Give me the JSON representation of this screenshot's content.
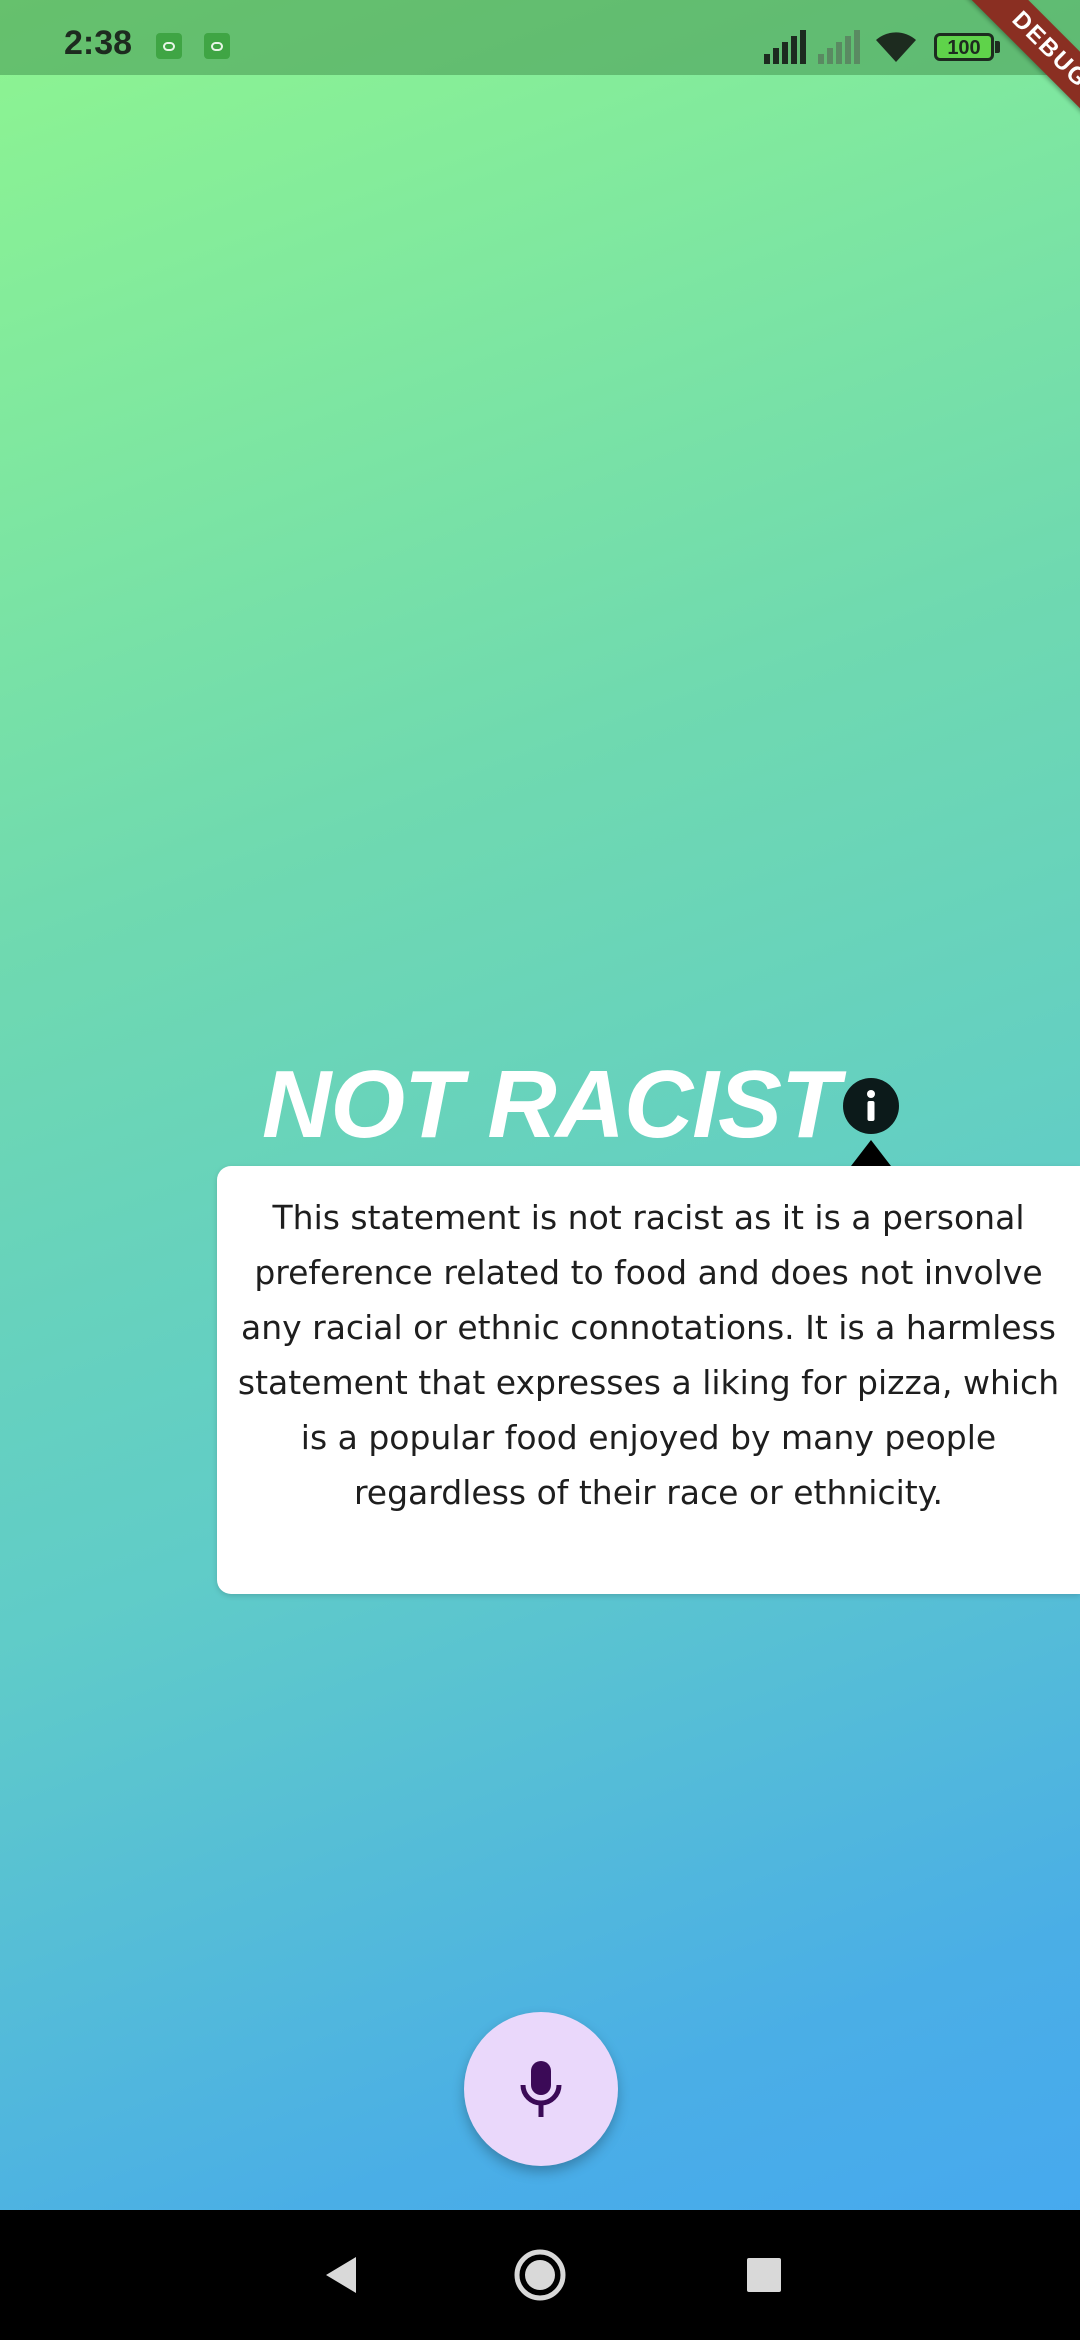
{
  "status_bar": {
    "time": "2:38",
    "battery": "100",
    "icons": [
      "android-notification-icon",
      "android-notification-icon",
      "signal-icon",
      "signal-empty-icon",
      "wifi-icon",
      "battery-icon",
      "charging-icon"
    ]
  },
  "debug_banner": "DEBUG",
  "result": {
    "verdict": "NOT RACIST",
    "explanation": "This statement is not racist as it is a personal preference related to food and does not involve any racial or ethnic connotations. It is a harmless statement that expresses a liking for pizza, which is a popular food enjoyed by many people regardless of their race or ethnicity."
  },
  "controls": {
    "info_icon": "info-icon",
    "mic_icon": "microphone-icon"
  },
  "nav_bar": {
    "icons": [
      "back-icon",
      "home-icon",
      "recents-icon"
    ]
  },
  "colors": {
    "gradient_top": "#8ef590",
    "gradient_bottom": "#45a7f2",
    "mic_button": "#ead8fb",
    "mic_icon": "#3b0a57",
    "debug_ribbon": "#8a2f22"
  }
}
